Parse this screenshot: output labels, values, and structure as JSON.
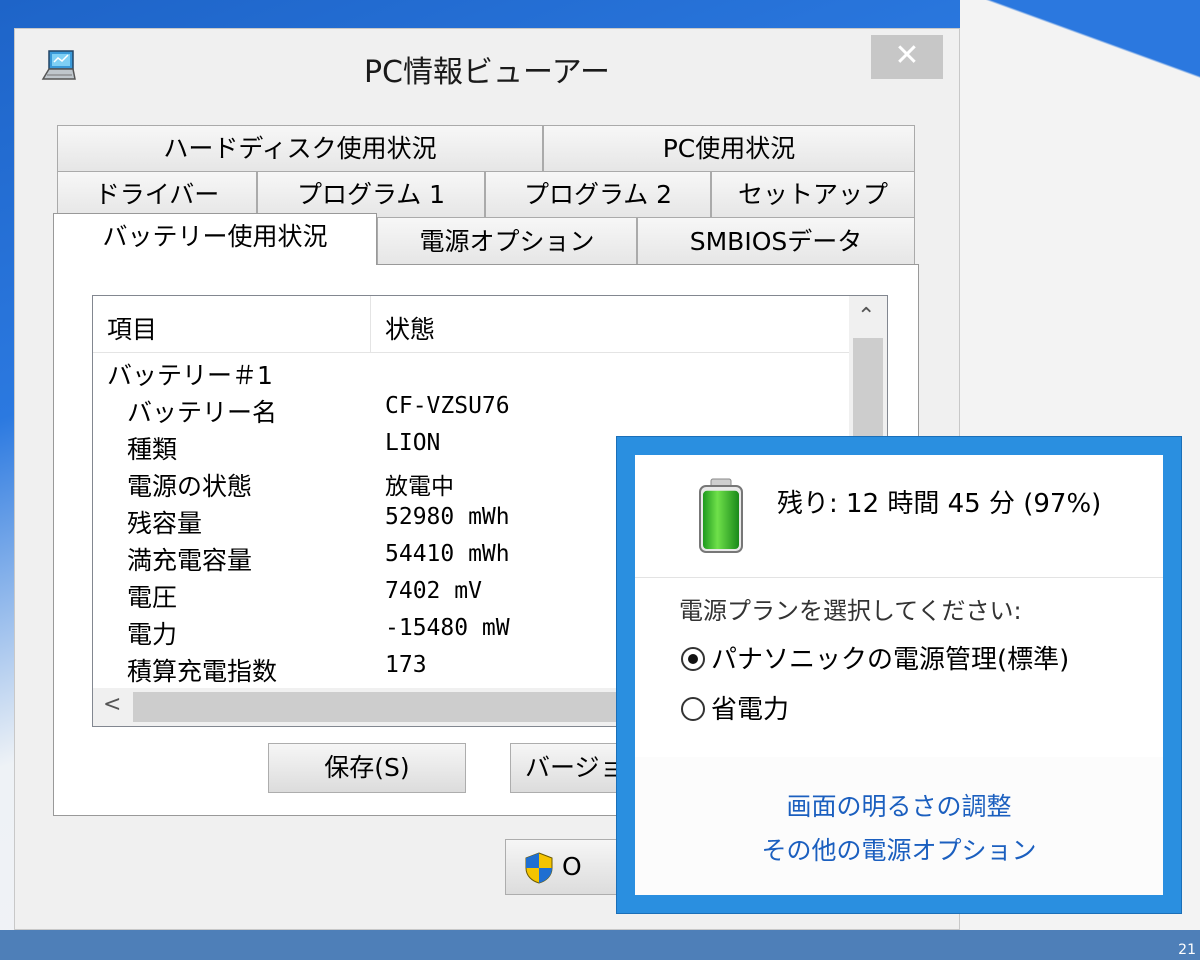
{
  "window": {
    "title": "PC情報ビューアー",
    "close_label": "✕"
  },
  "tabs": {
    "row1": [
      "ハードディスク使用状況",
      "PC使用状況"
    ],
    "row2": [
      "ドライバー",
      "プログラム 1",
      "プログラム 2",
      "セットアップ"
    ],
    "row3": [
      "バッテリー使用状況",
      "電源オプション",
      "SMBIOSデータ"
    ],
    "active": "バッテリー使用状況"
  },
  "list": {
    "col_item": "項目",
    "col_status": "状態",
    "rows": [
      {
        "name": "バッテリー＃1",
        "value": "",
        "indent": 0
      },
      {
        "name": "バッテリー名",
        "value": "CF-VZSU76",
        "indent": 1
      },
      {
        "name": "種類",
        "value": "LION",
        "indent": 1
      },
      {
        "name": "電源の状態",
        "value": "放電中",
        "indent": 1
      },
      {
        "name": "残容量",
        "value": "52980 mWh",
        "indent": 1
      },
      {
        "name": "満充電容量",
        "value": "54410 mWh",
        "indent": 1
      },
      {
        "name": "電圧",
        "value": "7402 mV",
        "indent": 1
      },
      {
        "name": "電力",
        "value": "-15480 mW",
        "indent": 1
      },
      {
        "name": "積算充電指数",
        "value": "173",
        "indent": 1
      }
    ]
  },
  "buttons": {
    "save": "保存(S)",
    "version": "バージョ",
    "ok": "O"
  },
  "flyout": {
    "remaining": "残り: 12 時間 45 分 (97%)",
    "battery_level": 0.97,
    "plan_prompt": "電源プランを選択してください:",
    "plans": [
      {
        "label": "パナソニックの電源管理(標準)",
        "selected": true
      },
      {
        "label": "省電力",
        "selected": false
      }
    ],
    "link_brightness": "画面の明るさの調整",
    "link_more": "その他の電源オプション",
    "accent": "#2a8fe0"
  },
  "taskbar": {
    "clock_fragment": "21"
  }
}
